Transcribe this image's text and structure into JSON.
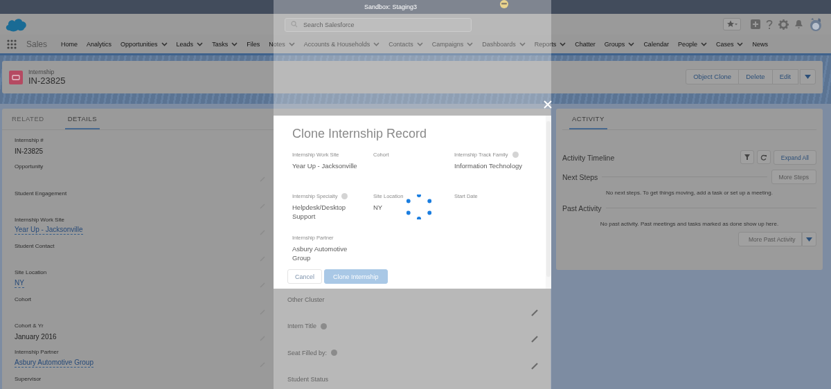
{
  "sandbox_banner": "Sandbox: Staging3",
  "header": {
    "search": {
      "placeholder": "Search Salesforce"
    }
  },
  "nav": {
    "app_name": "Sales",
    "items": [
      {
        "label": "Home",
        "dropdown": false
      },
      {
        "label": "Analytics",
        "dropdown": false
      },
      {
        "label": "Opportunities",
        "dropdown": true
      },
      {
        "label": "Leads",
        "dropdown": true
      },
      {
        "label": "Tasks",
        "dropdown": true
      },
      {
        "label": "Files",
        "dropdown": false
      },
      {
        "label": "Notes",
        "dropdown": true
      },
      {
        "label": "Accounts & Households",
        "dropdown": true
      },
      {
        "label": "Contacts",
        "dropdown": true
      },
      {
        "label": "Campaigns",
        "dropdown": true
      },
      {
        "label": "Dashboards",
        "dropdown": true
      },
      {
        "label": "Reports",
        "dropdown": true
      },
      {
        "label": "Chatter",
        "dropdown": false
      },
      {
        "label": "Groups",
        "dropdown": true
      },
      {
        "label": "Calendar",
        "dropdown": false
      },
      {
        "label": "People",
        "dropdown": true
      },
      {
        "label": "Cases",
        "dropdown": true
      },
      {
        "label": "News",
        "dropdown": false
      }
    ]
  },
  "record": {
    "object": "Internship",
    "name": "IN-23825",
    "actions": [
      "Object Clone",
      "Delete",
      "Edit"
    ]
  },
  "details": {
    "tabs": [
      {
        "label": "RELATED",
        "selected": false
      },
      {
        "label": "DETAILS",
        "selected": true
      }
    ],
    "left_fields": [
      {
        "label": "Internship #",
        "value": "IN-23825",
        "link": false,
        "editable": false
      },
      {
        "label": "Opportunity",
        "editable": true
      },
      {
        "label": "Student Engagement",
        "editable": true
      },
      {
        "label": "Internship Work Site",
        "value": "Year Up - Jacksonville",
        "link": true,
        "editable": true
      },
      {
        "label": "Student Contact",
        "editable": true
      },
      {
        "label": "Site Location",
        "value": "NY",
        "link": true,
        "editable": true
      },
      {
        "label": "Cohort",
        "editable": true
      },
      {
        "label": "Cohort & Yr",
        "value": "January 2016",
        "link": false,
        "editable": true
      },
      {
        "label": "Internship Partner",
        "value": "Asbury Automotive Group",
        "link": true,
        "editable": true
      },
      {
        "label": "Supervisor",
        "editable": false
      }
    ],
    "right_fields": [
      {
        "label": "Other Cluster",
        "info": false,
        "editable": true
      },
      {
        "label": "Intern Title",
        "info": true,
        "editable": true
      },
      {
        "label": "Seat Filled by:",
        "info": true,
        "editable": true
      },
      {
        "label": "Student Status",
        "info": false,
        "editable": false
      }
    ]
  },
  "modal": {
    "title": "Clone Internship Record",
    "loading": true,
    "fields": [
      {
        "label": "Internship Work Site",
        "value": "Year Up - Jacksonville",
        "info": false
      },
      {
        "label": "Cohort",
        "info": false
      },
      {
        "label": "Internship Track Family",
        "value": "Information Technology",
        "info": true
      },
      {
        "label": "Internship Specialty",
        "value": "Helpdesk/Desktop Support",
        "info": true
      },
      {
        "label": "Site Location",
        "value": "NY",
        "info": false
      },
      {
        "label": "Start Date",
        "info": false
      },
      {
        "label": "Internship Partner",
        "value": "Asbury Automotive Group",
        "info": false
      }
    ],
    "buttons": [
      {
        "label": "Cancel",
        "kind": "neutral"
      },
      {
        "label": "Clone Internship",
        "kind": "brand"
      }
    ]
  },
  "activity": {
    "tabs": [
      {
        "label": "ACTIVITY",
        "selected": true
      }
    ],
    "title": "Activity Timeline",
    "expand_all": "Expand All",
    "next_steps": {
      "title": "Next Steps",
      "button": "More Steps",
      "empty": "No next steps. To get things moving, add a task or set up a meeting."
    },
    "past": {
      "title": "Past Activity",
      "empty": "No past activity. Past meetings and tasks marked as done show up here.",
      "button": "More Past Activity"
    }
  }
}
